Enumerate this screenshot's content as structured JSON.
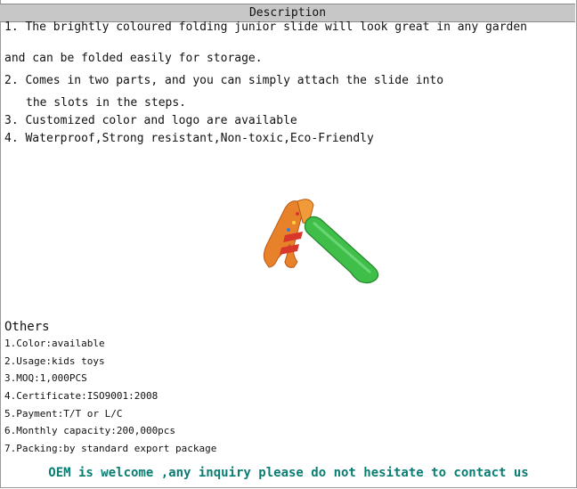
{
  "header": {
    "title": "Description"
  },
  "description": {
    "lines": [
      "1. The brightly coloured folding junior slide will look great in any garden",
      "and can be folded easily for storage.",
      "2. Comes in two parts, and you can simply attach the slide into",
      "the slots in the steps.",
      "3. Customized color and logo are available",
      "4. Waterproof,Strong resistant,Non-toxic,Eco-Friendly"
    ]
  },
  "product_image": {
    "icon": "folding-slide-image",
    "colors": {
      "steps": "#e8822a",
      "slide": "#3fbf4a"
    }
  },
  "others": {
    "title": "Others",
    "items": [
      "1.Color:available",
      "2.Usage:kids toys",
      "3.MOQ:1,000PCS",
      "4.Certificate:ISO9001:2008",
      "5.Payment:T/T or L/C",
      "6.Monthly capacity:200,000pcs",
      "7.Packing:by standard export package"
    ]
  },
  "footer": {
    "text": "OEM is welcome ,any inquiry please do not hesitate to contact us",
    "color": "#0a7d73"
  }
}
